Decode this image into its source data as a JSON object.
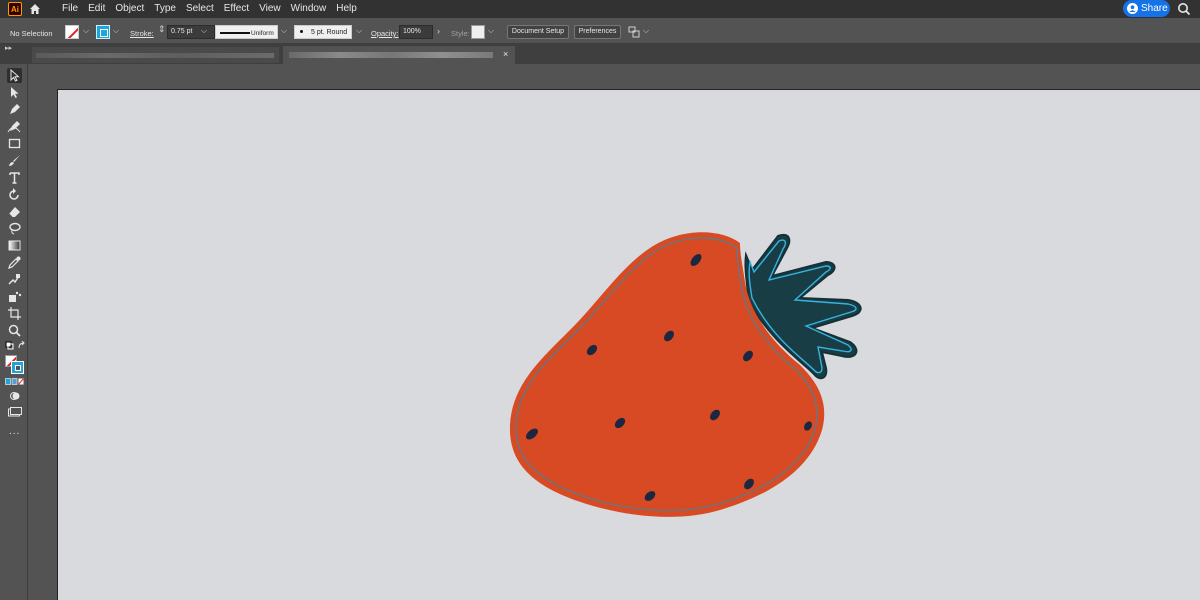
{
  "app": {
    "logo_label": "Ai"
  },
  "menu": {
    "items": [
      "File",
      "Edit",
      "Object",
      "Type",
      "Select",
      "Effect",
      "View",
      "Window",
      "Help"
    ]
  },
  "share": {
    "label": "Share"
  },
  "control_bar": {
    "selection_status": "No Selection",
    "stroke_label": "Stroke:",
    "stroke_weight": "0.75 pt",
    "variable_width_profile": "Uniform",
    "brush_definition": "5 pt. Round",
    "opacity_label": "Opacity:",
    "opacity_value": "100%",
    "style_label": "Style:",
    "document_setup_label": "Document Setup",
    "preferences_label": "Preferences"
  },
  "document_tab": {
    "close_glyph": "×"
  },
  "colors": {
    "accent": "#1473e6",
    "strawberry_body": "#d84a23",
    "strawberry_leaf": "#183d45",
    "outline_cyan": "#36b3e0",
    "seeds": "#1d2740",
    "artboard": "#d8dade"
  },
  "tools": [
    "selection-tool",
    "direct-selection-tool",
    "pen-tool",
    "curvature-tool",
    "rectangle-tool",
    "paintbrush-tool",
    "type-tool",
    "rotate-tool",
    "eraser-tool",
    "lasso-tool",
    "gradient-tool",
    "eyedropper-tool",
    "blend-tool",
    "symbol-sprayer-tool",
    "artboard-tool",
    "zoom-tool"
  ],
  "more_tools": "..."
}
